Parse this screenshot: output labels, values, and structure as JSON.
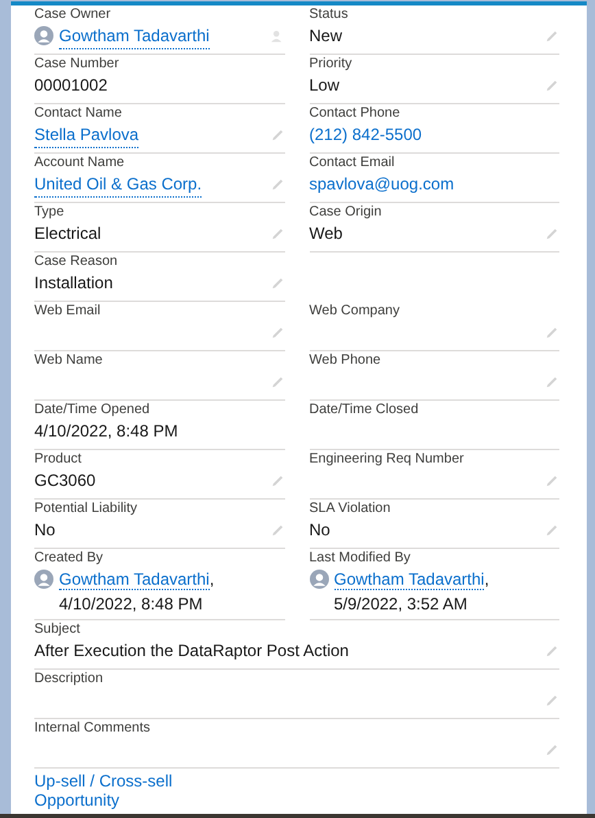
{
  "rows": [
    {
      "fields": [
        {
          "label": "Case Owner",
          "kind": "user",
          "name": "Gowtham Tadavarthi",
          "editable": true
        },
        {
          "label": "Status",
          "kind": "text",
          "value": "New",
          "editable": true
        }
      ]
    },
    {
      "fields": [
        {
          "label": "Case Number",
          "kind": "text",
          "value": "00001002",
          "editable": false
        },
        {
          "label": "Priority",
          "kind": "text",
          "value": "Low",
          "editable": true
        }
      ]
    },
    {
      "fields": [
        {
          "label": "Contact Name",
          "kind": "link",
          "value": "Stella Pavlova",
          "editable": true
        },
        {
          "label": "Contact Phone",
          "kind": "plain_link",
          "value": "(212) 842-5500",
          "editable": false
        }
      ]
    },
    {
      "fields": [
        {
          "label": "Account Name",
          "kind": "link",
          "value": "United Oil & Gas Corp.",
          "editable": true
        },
        {
          "label": "Contact Email",
          "kind": "plain_link",
          "value": "spavlova@uog.com",
          "editable": false
        }
      ]
    },
    {
      "fields": [
        {
          "label": "Type",
          "kind": "text",
          "value": "Electrical",
          "editable": true
        },
        {
          "label": "Case Origin",
          "kind": "text",
          "value": "Web",
          "editable": true
        }
      ]
    },
    {
      "fields": [
        {
          "label": "Case Reason",
          "kind": "text",
          "value": "Installation",
          "editable": true
        }
      ]
    },
    {
      "fields": [
        {
          "label": "Web Email",
          "kind": "text",
          "editable": true
        },
        {
          "label": "Web Company",
          "kind": "text",
          "editable": true
        }
      ]
    },
    {
      "fields": [
        {
          "label": "Web Name",
          "kind": "text",
          "editable": true
        },
        {
          "label": "Web Phone",
          "kind": "text",
          "editable": true
        }
      ]
    },
    {
      "fields": [
        {
          "label": "Date/Time Opened",
          "kind": "text",
          "value": "4/10/2022, 8:48 PM",
          "editable": false
        },
        {
          "label": "Date/Time Closed",
          "kind": "text",
          "editable": false
        }
      ]
    },
    {
      "fields": [
        {
          "label": "Product",
          "kind": "text",
          "value": "GC3060",
          "editable": true
        },
        {
          "label": "Engineering Req Number",
          "kind": "text",
          "editable": true
        }
      ]
    },
    {
      "fields": [
        {
          "label": "Potential Liability",
          "kind": "text",
          "value": "No",
          "editable": true
        },
        {
          "label": "SLA Violation",
          "kind": "text",
          "value": "No",
          "editable": true
        }
      ]
    },
    {
      "fields": [
        {
          "label": "Created By",
          "kind": "user",
          "name": "Gowtham Tadavarthi",
          "suffix": ", 4/10/2022, 8:48 PM",
          "editable": false
        },
        {
          "label": "Last Modified By",
          "kind": "user",
          "name": "Gowtham Tadavarthi",
          "suffix": ", 5/9/2022, 3:52 AM",
          "editable": false
        }
      ]
    },
    {
      "wide": true,
      "fields": [
        {
          "label": "Subject",
          "kind": "text",
          "value": "After Execution the DataRaptor Post Action",
          "editable": true
        }
      ]
    },
    {
      "wide": true,
      "fields": [
        {
          "label": "Description",
          "kind": "text",
          "editable": true
        }
      ]
    },
    {
      "wide": true,
      "fields": [
        {
          "label": "Internal Comments",
          "kind": "text",
          "editable": true
        }
      ]
    }
  ],
  "section_link": "Up-sell / Cross-sell Opportunity"
}
